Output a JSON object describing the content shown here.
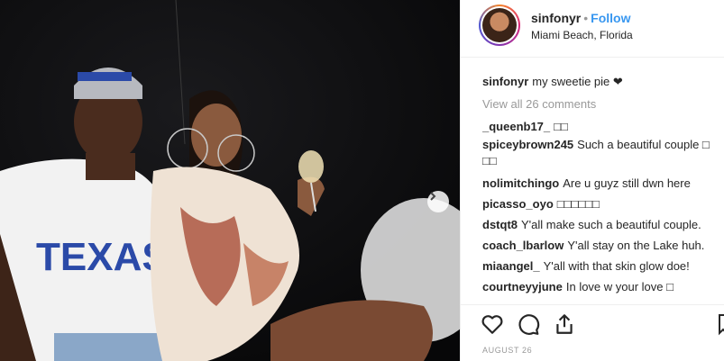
{
  "post": {
    "username": "sinfonyr",
    "follow_label": "Follow",
    "separator": "•",
    "location": "Miami Beach, Florida",
    "date": "AUGUST 26"
  },
  "caption": {
    "username": "sinfonyr",
    "text": "my sweetie pie ❤"
  },
  "view_all": "View all 26 comments",
  "comments": [
    {
      "username": "_queenb17_",
      "text": "□□"
    },
    {
      "username": "spiceybrown245",
      "text": "Such a beautiful couple □ □□"
    },
    {
      "username": "nolimitchingo",
      "text": "Are u guyz still dwn here"
    },
    {
      "username": "picasso_oyo",
      "text": "□□□□□□"
    },
    {
      "username": "dstqt8",
      "text": "Y'all make such a beautiful couple."
    },
    {
      "username": "coach_lbarlow",
      "text": "Y'all stay on the Lake huh."
    },
    {
      "username": "miaangel_",
      "text": "Y'all with that skin glow doe!"
    },
    {
      "username": "courtneyyjune",
      "text": "In love w your love □"
    }
  ],
  "photo": {
    "jersey_text": "TEXAS"
  },
  "icons": {
    "like": "heart-icon",
    "comment": "comment-icon",
    "share": "share-icon",
    "save": "bookmark-icon",
    "next": "chevron-right-icon"
  },
  "colors": {
    "link": "#3897f0",
    "muted": "#999999",
    "text": "#262626"
  }
}
